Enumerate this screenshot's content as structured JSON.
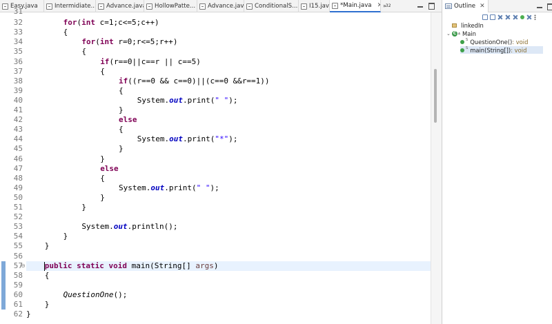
{
  "tabs": [
    {
      "label": "Easy.java",
      "active": false
    },
    {
      "label": "Intermidiate...",
      "active": false
    },
    {
      "label": "Advance.java",
      "active": false
    },
    {
      "label": "HollowPatte...",
      "active": false
    },
    {
      "label": "Advance.java",
      "active": false
    },
    {
      "label": "ConditionalS...",
      "active": false
    },
    {
      "label": "I15.java",
      "active": false
    },
    {
      "label": "*Main.java",
      "active": true
    }
  ],
  "tab_overflow": "»",
  "tab_overflow_count": "32",
  "editor": {
    "first_line_number": "31",
    "lines": [
      {
        "num": "32",
        "indent": 8,
        "parts": [
          [
            "kw",
            "for"
          ],
          [
            "",
            "("
          ],
          [
            "kw",
            "int"
          ],
          [
            "",
            " c=1;c<=5;c++)"
          ]
        ]
      },
      {
        "num": "33",
        "indent": 8,
        "parts": [
          [
            "",
            "{"
          ]
        ]
      },
      {
        "num": "34",
        "indent": 12,
        "parts": [
          [
            "kw",
            "for"
          ],
          [
            "",
            "("
          ],
          [
            "kw",
            "int"
          ],
          [
            "",
            " r=0;r<=5;r++)"
          ]
        ]
      },
      {
        "num": "35",
        "indent": 12,
        "parts": [
          [
            "",
            "{"
          ]
        ]
      },
      {
        "num": "36",
        "indent": 16,
        "parts": [
          [
            "kw",
            "if"
          ],
          [
            "",
            "(r==0||c==r || c==5)"
          ]
        ]
      },
      {
        "num": "37",
        "indent": 16,
        "parts": [
          [
            "",
            "{"
          ]
        ]
      },
      {
        "num": "38",
        "indent": 20,
        "parts": [
          [
            "kw",
            "if"
          ],
          [
            "",
            "((r==0 && c==0)||(c==0 &&r==1))"
          ]
        ]
      },
      {
        "num": "39",
        "indent": 20,
        "parts": [
          [
            "",
            "{"
          ]
        ]
      },
      {
        "num": "40",
        "indent": 24,
        "parts": [
          [
            "",
            "System."
          ],
          [
            "fld",
            "out"
          ],
          [
            "",
            ".print("
          ],
          [
            "str",
            "\" \""
          ],
          [
            "",
            ");"
          ]
        ]
      },
      {
        "num": "41",
        "indent": 20,
        "parts": [
          [
            "",
            "}"
          ]
        ]
      },
      {
        "num": "42",
        "indent": 20,
        "parts": [
          [
            "kw",
            "else"
          ]
        ]
      },
      {
        "num": "43",
        "indent": 20,
        "parts": [
          [
            "",
            "{"
          ]
        ]
      },
      {
        "num": "44",
        "indent": 24,
        "parts": [
          [
            "",
            "System."
          ],
          [
            "fld",
            "out"
          ],
          [
            "",
            ".print("
          ],
          [
            "str",
            "\"*\""
          ],
          [
            "",
            ");"
          ]
        ]
      },
      {
        "num": "45",
        "indent": 20,
        "parts": [
          [
            "",
            "}"
          ]
        ]
      },
      {
        "num": "46",
        "indent": 16,
        "parts": [
          [
            "",
            "}"
          ]
        ]
      },
      {
        "num": "47",
        "indent": 16,
        "parts": [
          [
            "kw",
            "else"
          ]
        ]
      },
      {
        "num": "48",
        "indent": 16,
        "parts": [
          [
            "",
            "{"
          ]
        ]
      },
      {
        "num": "49",
        "indent": 20,
        "parts": [
          [
            "",
            "System."
          ],
          [
            "fld",
            "out"
          ],
          [
            "",
            ".print("
          ],
          [
            "str",
            "\" \""
          ],
          [
            "",
            ");"
          ]
        ]
      },
      {
        "num": "50",
        "indent": 16,
        "parts": [
          [
            "",
            "}"
          ]
        ]
      },
      {
        "num": "51",
        "indent": 12,
        "parts": [
          [
            "",
            "}"
          ]
        ]
      },
      {
        "num": "52",
        "indent": 12,
        "parts": []
      },
      {
        "num": "53",
        "indent": 12,
        "parts": [
          [
            "",
            "System."
          ],
          [
            "fld",
            "out"
          ],
          [
            "",
            ".println();"
          ]
        ]
      },
      {
        "num": "54",
        "indent": 8,
        "parts": [
          [
            "",
            "}"
          ]
        ]
      },
      {
        "num": "55",
        "indent": 4,
        "parts": [
          [
            "",
            "}"
          ]
        ]
      },
      {
        "num": "56",
        "indent": 4,
        "parts": []
      },
      {
        "num": "57",
        "indent": 4,
        "parts": [
          [
            "kw",
            "public"
          ],
          [
            "",
            " "
          ],
          [
            "kw",
            "static"
          ],
          [
            "",
            " "
          ],
          [
            "kw",
            "void"
          ],
          [
            "",
            " main(String[] "
          ],
          [
            "arg",
            "args"
          ],
          [
            "",
            ")"
          ]
        ],
        "highlight": true,
        "fold": true
      },
      {
        "num": "58",
        "indent": 4,
        "parts": [
          [
            "",
            "{"
          ]
        ]
      },
      {
        "num": "59",
        "indent": 4,
        "parts": []
      },
      {
        "num": "60",
        "indent": 8,
        "parts": [
          [
            "sm",
            "QuestionOne"
          ],
          [
            "",
            "();"
          ]
        ]
      },
      {
        "num": "61",
        "indent": 4,
        "parts": [
          [
            "",
            "}"
          ]
        ]
      },
      {
        "num": "62",
        "indent": 0,
        "parts": [
          [
            "",
            "}"
          ]
        ]
      }
    ]
  },
  "outline": {
    "title": "Outline",
    "nodes": [
      {
        "label": "linkedIn",
        "type": "package"
      },
      {
        "label": "Main",
        "type": "class",
        "expanded": true
      },
      {
        "label": "QuestionOne()",
        "ret": " : void",
        "type": "method"
      },
      {
        "label": "main(String[])",
        "ret": " : void",
        "type": "method",
        "selected": true
      }
    ]
  }
}
